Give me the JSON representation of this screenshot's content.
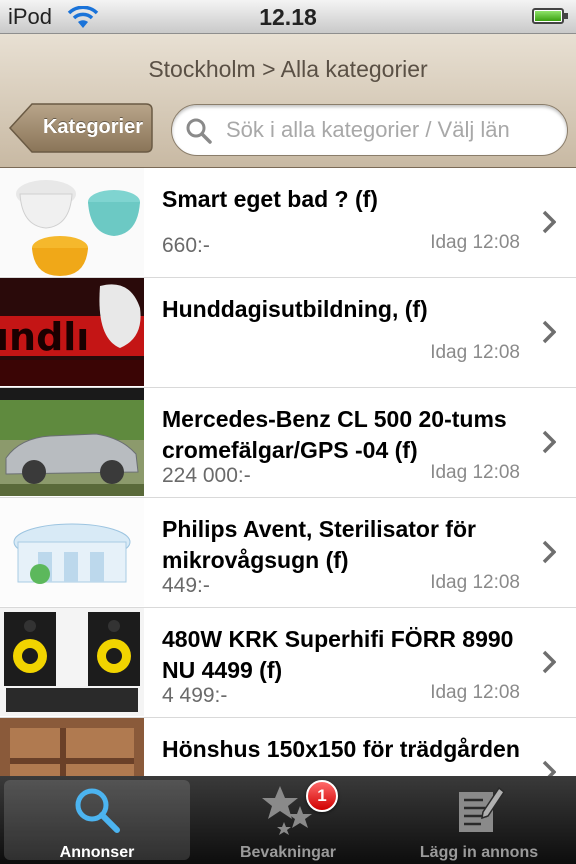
{
  "status_bar": {
    "carrier": "iPod",
    "time": "12.18"
  },
  "nav": {
    "title": "Stockholm > Alla kategorier",
    "back_label": "Kategorier",
    "search_placeholder": "Sök i alla kategorier / Välj län"
  },
  "listings": [
    {
      "title": "Smart eget bad ? (f)",
      "price": "660:-",
      "date": "Idag 12:08"
    },
    {
      "title": "Hunddagisutbildning, (f)",
      "price": "",
      "date": "Idag 12:08"
    },
    {
      "title": "Mercedes-Benz CL 500 20-tums cromefälgar/GPS -04 (f)",
      "price": "224 000:-",
      "date": "Idag 12:08"
    },
    {
      "title": "Philips Avent, Sterilisator för mikrovågsugn (f)",
      "price": "449:-",
      "date": "Idag 12:08"
    },
    {
      "title": "480W KRK Superhifi FÖRR 8990 NU 4499 (f)",
      "price": "4 499:-",
      "date": "Idag 12:08"
    },
    {
      "title": "Hönshus 150x150 för trädgården",
      "price": "",
      "date": ""
    }
  ],
  "tabs": [
    {
      "label": "Annonser",
      "icon": "search-icon"
    },
    {
      "label": "Bevakningar",
      "icon": "stars-icon",
      "badge": "1"
    },
    {
      "label": "Lägg in annons",
      "icon": "edit-icon"
    }
  ],
  "colors": {
    "nav_top": "#e8e0d3",
    "nav_bottom": "#c8b9a3",
    "badge": "#d00000",
    "tab_active_icon": "#4cb4f0"
  }
}
